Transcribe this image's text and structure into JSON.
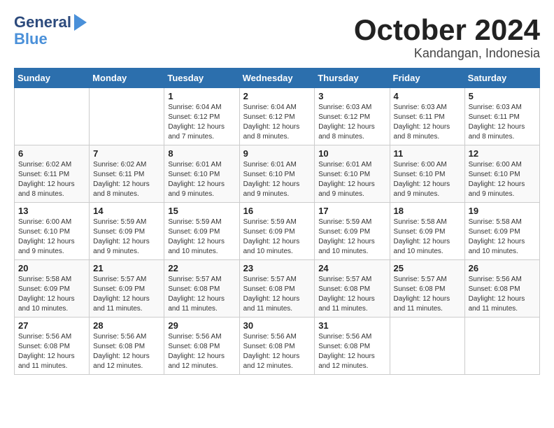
{
  "header": {
    "logo_line1": "General",
    "logo_line2": "Blue",
    "month": "October 2024",
    "location": "Kandangan, Indonesia"
  },
  "weekdays": [
    "Sunday",
    "Monday",
    "Tuesday",
    "Wednesday",
    "Thursday",
    "Friday",
    "Saturday"
  ],
  "weeks": [
    [
      {
        "day": "",
        "info": ""
      },
      {
        "day": "",
        "info": ""
      },
      {
        "day": "1",
        "info": "Sunrise: 6:04 AM\nSunset: 6:12 PM\nDaylight: 12 hours and 7 minutes."
      },
      {
        "day": "2",
        "info": "Sunrise: 6:04 AM\nSunset: 6:12 PM\nDaylight: 12 hours and 8 minutes."
      },
      {
        "day": "3",
        "info": "Sunrise: 6:03 AM\nSunset: 6:12 PM\nDaylight: 12 hours and 8 minutes."
      },
      {
        "day": "4",
        "info": "Sunrise: 6:03 AM\nSunset: 6:11 PM\nDaylight: 12 hours and 8 minutes."
      },
      {
        "day": "5",
        "info": "Sunrise: 6:03 AM\nSunset: 6:11 PM\nDaylight: 12 hours and 8 minutes."
      }
    ],
    [
      {
        "day": "6",
        "info": "Sunrise: 6:02 AM\nSunset: 6:11 PM\nDaylight: 12 hours and 8 minutes."
      },
      {
        "day": "7",
        "info": "Sunrise: 6:02 AM\nSunset: 6:11 PM\nDaylight: 12 hours and 8 minutes."
      },
      {
        "day": "8",
        "info": "Sunrise: 6:01 AM\nSunset: 6:10 PM\nDaylight: 12 hours and 9 minutes."
      },
      {
        "day": "9",
        "info": "Sunrise: 6:01 AM\nSunset: 6:10 PM\nDaylight: 12 hours and 9 minutes."
      },
      {
        "day": "10",
        "info": "Sunrise: 6:01 AM\nSunset: 6:10 PM\nDaylight: 12 hours and 9 minutes."
      },
      {
        "day": "11",
        "info": "Sunrise: 6:00 AM\nSunset: 6:10 PM\nDaylight: 12 hours and 9 minutes."
      },
      {
        "day": "12",
        "info": "Sunrise: 6:00 AM\nSunset: 6:10 PM\nDaylight: 12 hours and 9 minutes."
      }
    ],
    [
      {
        "day": "13",
        "info": "Sunrise: 6:00 AM\nSunset: 6:10 PM\nDaylight: 12 hours and 9 minutes."
      },
      {
        "day": "14",
        "info": "Sunrise: 5:59 AM\nSunset: 6:09 PM\nDaylight: 12 hours and 9 minutes."
      },
      {
        "day": "15",
        "info": "Sunrise: 5:59 AM\nSunset: 6:09 PM\nDaylight: 12 hours and 10 minutes."
      },
      {
        "day": "16",
        "info": "Sunrise: 5:59 AM\nSunset: 6:09 PM\nDaylight: 12 hours and 10 minutes."
      },
      {
        "day": "17",
        "info": "Sunrise: 5:59 AM\nSunset: 6:09 PM\nDaylight: 12 hours and 10 minutes."
      },
      {
        "day": "18",
        "info": "Sunrise: 5:58 AM\nSunset: 6:09 PM\nDaylight: 12 hours and 10 minutes."
      },
      {
        "day": "19",
        "info": "Sunrise: 5:58 AM\nSunset: 6:09 PM\nDaylight: 12 hours and 10 minutes."
      }
    ],
    [
      {
        "day": "20",
        "info": "Sunrise: 5:58 AM\nSunset: 6:09 PM\nDaylight: 12 hours and 10 minutes."
      },
      {
        "day": "21",
        "info": "Sunrise: 5:57 AM\nSunset: 6:09 PM\nDaylight: 12 hours and 11 minutes."
      },
      {
        "day": "22",
        "info": "Sunrise: 5:57 AM\nSunset: 6:08 PM\nDaylight: 12 hours and 11 minutes."
      },
      {
        "day": "23",
        "info": "Sunrise: 5:57 AM\nSunset: 6:08 PM\nDaylight: 12 hours and 11 minutes."
      },
      {
        "day": "24",
        "info": "Sunrise: 5:57 AM\nSunset: 6:08 PM\nDaylight: 12 hours and 11 minutes."
      },
      {
        "day": "25",
        "info": "Sunrise: 5:57 AM\nSunset: 6:08 PM\nDaylight: 12 hours and 11 minutes."
      },
      {
        "day": "26",
        "info": "Sunrise: 5:56 AM\nSunset: 6:08 PM\nDaylight: 12 hours and 11 minutes."
      }
    ],
    [
      {
        "day": "27",
        "info": "Sunrise: 5:56 AM\nSunset: 6:08 PM\nDaylight: 12 hours and 11 minutes."
      },
      {
        "day": "28",
        "info": "Sunrise: 5:56 AM\nSunset: 6:08 PM\nDaylight: 12 hours and 12 minutes."
      },
      {
        "day": "29",
        "info": "Sunrise: 5:56 AM\nSunset: 6:08 PM\nDaylight: 12 hours and 12 minutes."
      },
      {
        "day": "30",
        "info": "Sunrise: 5:56 AM\nSunset: 6:08 PM\nDaylight: 12 hours and 12 minutes."
      },
      {
        "day": "31",
        "info": "Sunrise: 5:56 AM\nSunset: 6:08 PM\nDaylight: 12 hours and 12 minutes."
      },
      {
        "day": "",
        "info": ""
      },
      {
        "day": "",
        "info": ""
      }
    ]
  ]
}
